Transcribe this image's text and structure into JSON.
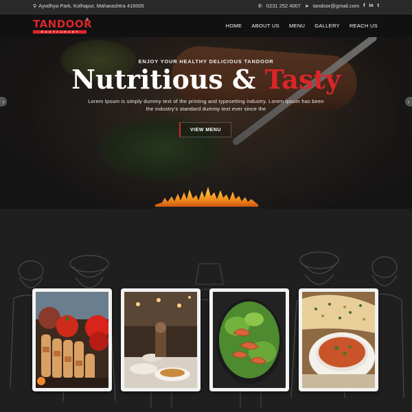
{
  "topbar": {
    "address": "Ayodhya Park, Kolhapur, Maharashtra 416005",
    "phone": "0231 252 4007",
    "email": "tandoor@gmail.com",
    "social": [
      "f",
      "in",
      "t"
    ]
  },
  "brand": {
    "name": "TANDOOR",
    "tagline": "RESTAURANT",
    "reg_mark": "®"
  },
  "nav": [
    "HOME",
    "ABOUT US",
    "MENU",
    "GALLERY",
    "REACH US"
  ],
  "hero": {
    "subtitle": "ENJOY YOUR HEALTHY DELICIOUS TANDOOR",
    "title_main": "Nutritious & ",
    "title_accent": "Tasty",
    "description": "Lorem Ipsum is simply dummy text of the printing and typesetting industry. Lorem Ipsum has been the industry's standard dummy text ever since the",
    "button": "VIEW MENU",
    "prev_icon": "chevron-left-icon",
    "next_icon": "chevron-right-icon"
  },
  "cards": [
    {
      "name": "kebab-skewers-photo"
    },
    {
      "name": "restaurant-interior-photo"
    },
    {
      "name": "prawn-salad-photo"
    },
    {
      "name": "naan-curry-photo"
    }
  ],
  "colors": {
    "accent": "#d9262a",
    "dark": "#111111",
    "section": "#1f1f1f"
  }
}
